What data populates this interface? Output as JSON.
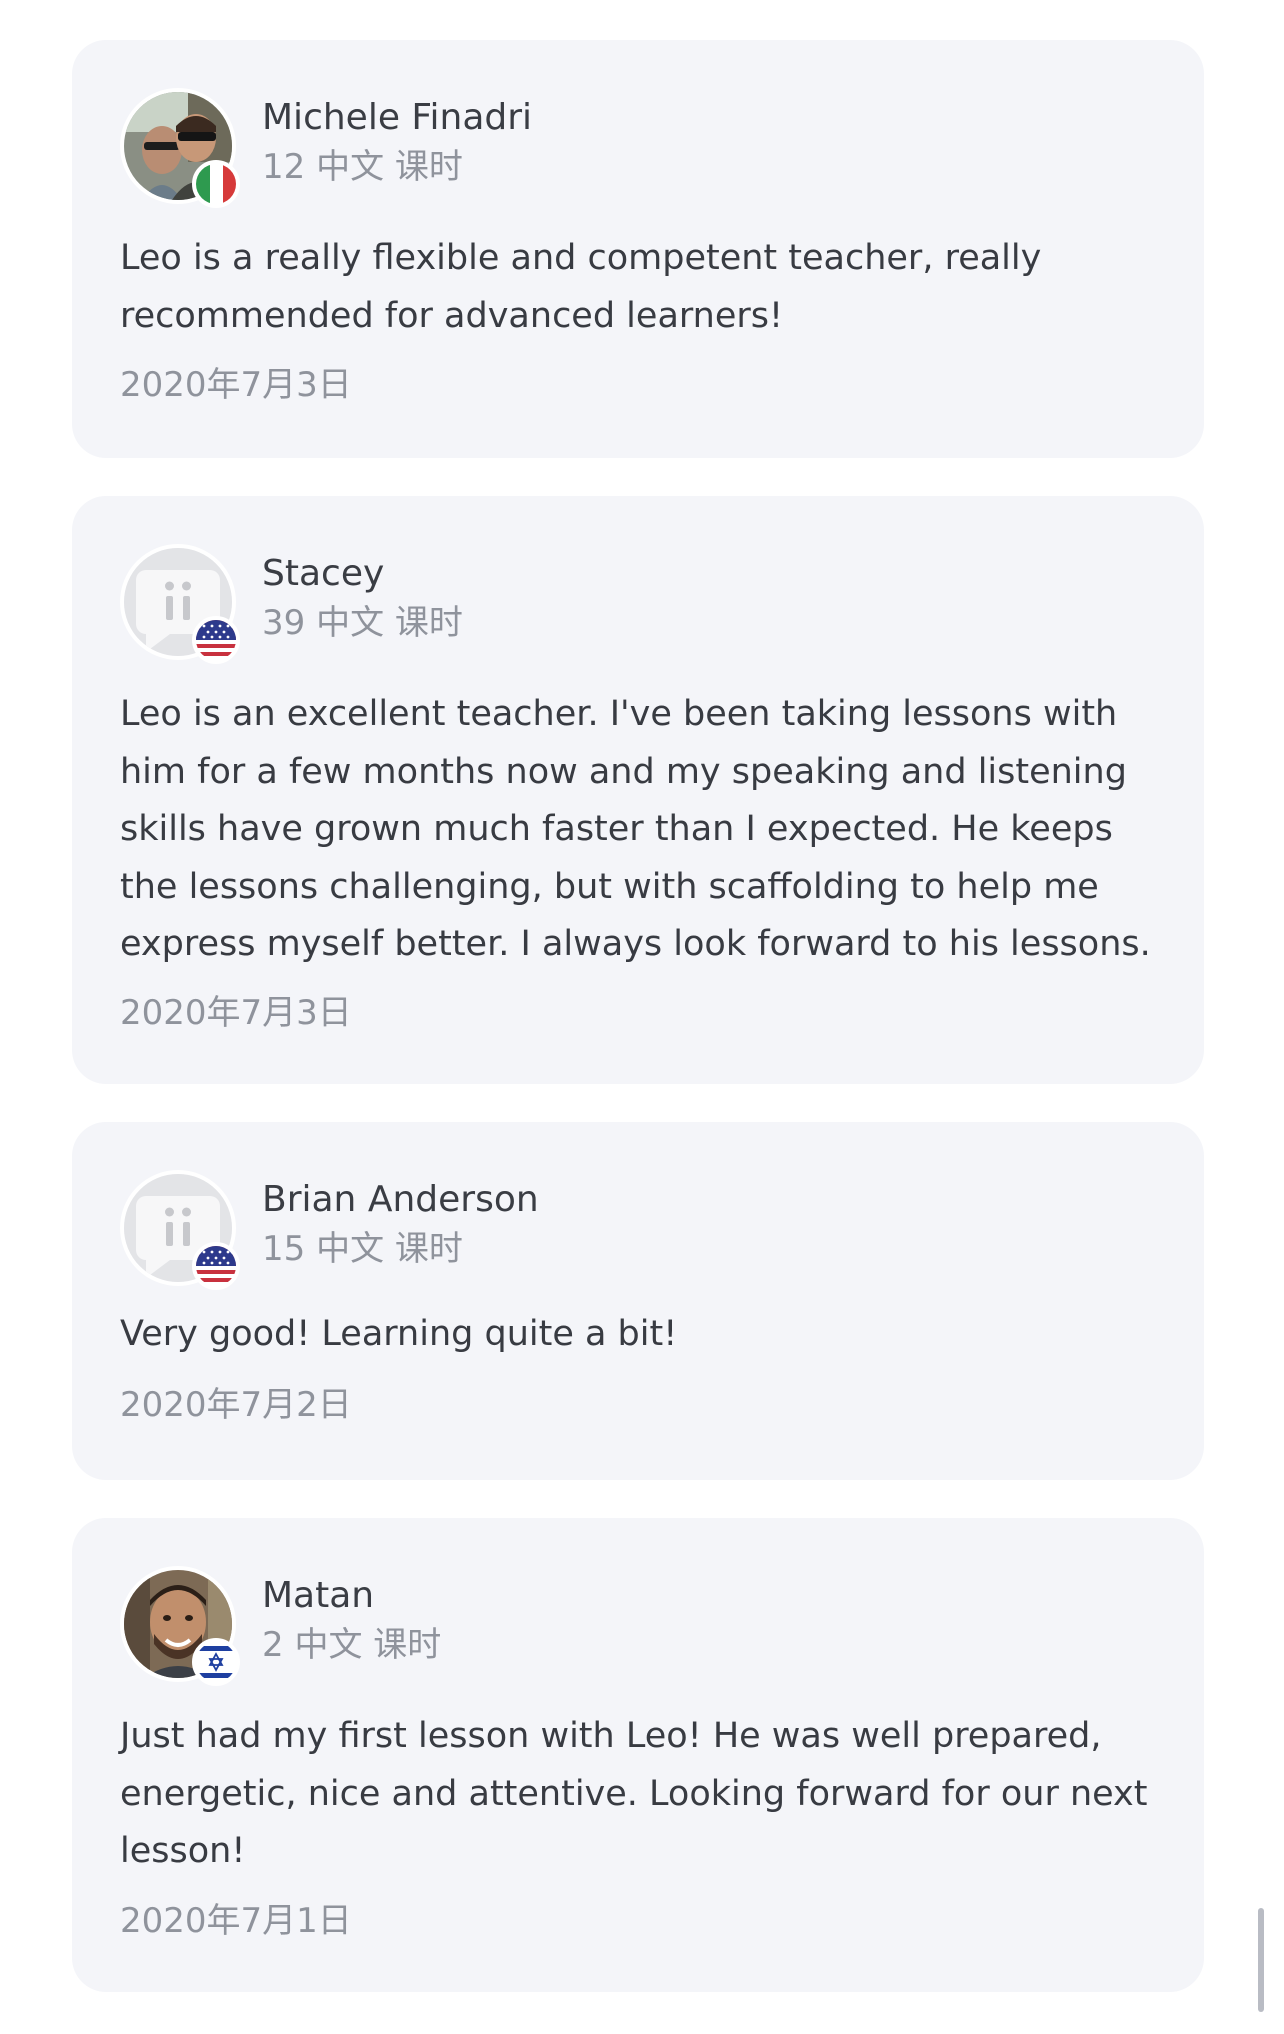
{
  "reviews": [
    {
      "name": "Michele Finadri",
      "lessons": "12 中文 课时",
      "comment": "Leo is a really flexible and competent teacher, really recommended for advanced learners!",
      "date": "2020年7月3日",
      "avatar": "photo",
      "flag": "italy-flag-icon"
    },
    {
      "name": "Stacey",
      "lessons": "39 中文 课时",
      "comment": "Leo is an excellent teacher. I've been taking lessons with him for a few months now and my speaking and listening skills have grown much faster than I expected. He keeps the lessons challenging, but with scaffolding to help me express myself better. I always look forward to his lessons.",
      "date": "2020年7月3日",
      "avatar": "default-avatar-icon",
      "flag": "usa-flag-icon"
    },
    {
      "name": "Brian Anderson",
      "lessons": "15 中文 课时",
      "comment": "Very good! Learning quite a bit!",
      "date": "2020年7月2日",
      "avatar": "default-avatar-icon",
      "flag": "usa-flag-icon"
    },
    {
      "name": "Matan",
      "lessons": "2 中文 课时",
      "comment": "Just had my first lesson with Leo! He was well prepared, energetic, nice and attentive. Looking forward for our next lesson!",
      "date": "2020年7月1日",
      "avatar": "photo",
      "flag": "israel-flag-icon"
    }
  ],
  "colors": {
    "card_background": "#f4f5f9",
    "name_text": "#3a3d44",
    "muted_text": "#8f939c",
    "body_text": "#383b42"
  }
}
